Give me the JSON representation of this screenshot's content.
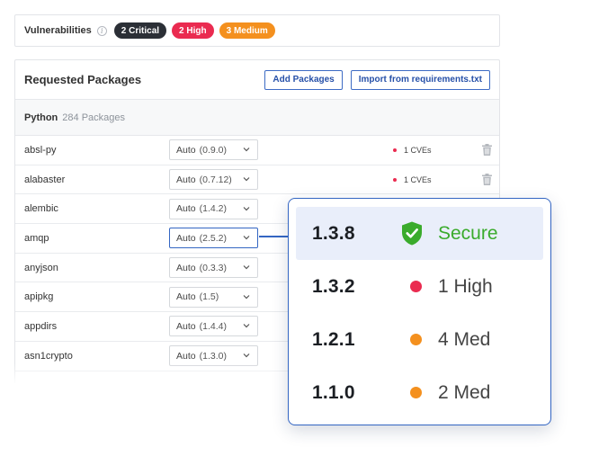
{
  "vulnerabilities": {
    "label": "Vulnerabilities",
    "info_icon": "i",
    "badges": [
      {
        "text": "2 Critical",
        "color": "#2b2f36"
      },
      {
        "text": "2 High",
        "color": "#ea2b50"
      },
      {
        "text": "3 Medium",
        "color": "#f4901e"
      }
    ]
  },
  "panel": {
    "title": "Requested Packages",
    "add_button": "Add Packages",
    "import_button": "Import from requirements.txt",
    "section": {
      "language": "Python",
      "count": "284 Packages"
    },
    "rows": [
      {
        "name": "absl-py",
        "mode": "Auto",
        "version": "(0.9.0)",
        "cve": "1 CVEs"
      },
      {
        "name": "alabaster",
        "mode": "Auto",
        "version": "(0.7.12)",
        "cve": "1 CVEs"
      },
      {
        "name": "alembic",
        "mode": "Auto",
        "version": "(1.4.2)",
        "cve": ""
      },
      {
        "name": "amqp",
        "mode": "Auto",
        "version": "(2.5.2)",
        "cve": ""
      },
      {
        "name": "anyjson",
        "mode": "Auto",
        "version": "(0.3.3)",
        "cve": ""
      },
      {
        "name": "apipkg",
        "mode": "Auto",
        "version": "(1.5)",
        "cve": ""
      },
      {
        "name": "appdirs",
        "mode": "Auto",
        "version": "(1.4.4)",
        "cve": ""
      },
      {
        "name": "asn1crypto",
        "mode": "Auto",
        "version": "(1.3.0)",
        "cve": ""
      }
    ]
  },
  "popover": {
    "options": [
      {
        "version": "1.3.8",
        "status": "Secure",
        "icon": "shield-check-icon",
        "color": "#3aab2c"
      },
      {
        "version": "1.3.2",
        "status": "1 High",
        "icon": "dot-icon",
        "color": "#ea2b50"
      },
      {
        "version": "1.2.1",
        "status": "4 Med",
        "icon": "dot-icon",
        "color": "#f4901e"
      },
      {
        "version": "1.1.0",
        "status": "2 Med",
        "icon": "dot-icon",
        "color": "#f4901e"
      }
    ]
  },
  "colors": {
    "accent": "#3466c3",
    "critical": "#2b2f36",
    "high": "#ea2b50",
    "medium": "#f4901e",
    "secure": "#3aab2c"
  }
}
